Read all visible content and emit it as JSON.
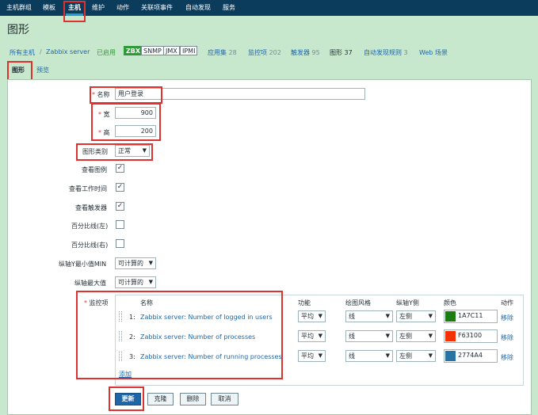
{
  "nav": {
    "items": [
      "主机群组",
      "模板",
      "主机",
      "维护",
      "动作",
      "关联项事件",
      "自动发现",
      "服务"
    ],
    "active": "主机"
  },
  "page": {
    "title": "图形"
  },
  "breadcrumb": {
    "all_hosts": "所有主机",
    "separator": "/",
    "host": "Zabbix server",
    "status": "已启用",
    "badges": [
      "ZBX",
      "SNMP",
      "JMX",
      "IPMI"
    ],
    "links": [
      {
        "label": "应用集",
        "count": "28"
      },
      {
        "label": "监控项",
        "count": "202"
      },
      {
        "label": "触发器",
        "count": "95"
      },
      {
        "label": "图形",
        "count": "37"
      },
      {
        "label": "自动发现规则",
        "count": "3"
      },
      {
        "label": "Web 场景",
        "count": ""
      }
    ]
  },
  "tabs": [
    "图形",
    "预览"
  ],
  "form": {
    "name_label": "名称",
    "name_value": "用户登录",
    "width_label": "宽",
    "width_value": "900",
    "height_label": "高",
    "height_value": "200",
    "graph_type_label": "图形类别",
    "graph_type_value": "正常",
    "show_legend_label": "查看图例",
    "show_working_time_label": "查看工作时间",
    "show_triggers_label": "查看触发器",
    "percent_left_label": "百分比线(左)",
    "percent_right_label": "百分比线(右)",
    "ymin_label": "纵轴Y最小值MIN",
    "ymin_value": "可计算的",
    "ymax_label": "纵轴最大值",
    "ymax_value": "可计算的",
    "items_label": "监控项",
    "checked_mark": "✓"
  },
  "items_table": {
    "headers": {
      "name": "名称",
      "function": "功能",
      "draw_style": "绘图风格",
      "y_side": "纵轴Y侧",
      "color": "颜色",
      "action": "动作"
    },
    "rows": [
      {
        "num": "1:",
        "name": "Zabbix server: Number of logged in users",
        "function": "平均",
        "draw_style": "线",
        "y_side": "左侧",
        "color": "1A7C11",
        "action": "移除"
      },
      {
        "num": "2:",
        "name": "Zabbix server: Number of processes",
        "function": "平均",
        "draw_style": "线",
        "y_side": "左侧",
        "color": "F63100",
        "action": "移除"
      },
      {
        "num": "3:",
        "name": "Zabbix server: Number of running processes",
        "function": "平均",
        "draw_style": "线",
        "y_side": "左侧",
        "color": "2774A4",
        "action": "移除"
      }
    ],
    "add_label": "添加"
  },
  "buttons": {
    "update": "更新",
    "clone": "克隆",
    "delete": "删除",
    "cancel": "取消"
  },
  "colors": {
    "row1": "#1A7C11",
    "row2": "#F63100",
    "row3": "#2774A4",
    "highlight": "#e03131",
    "nav_bg": "#0c3c5c"
  }
}
